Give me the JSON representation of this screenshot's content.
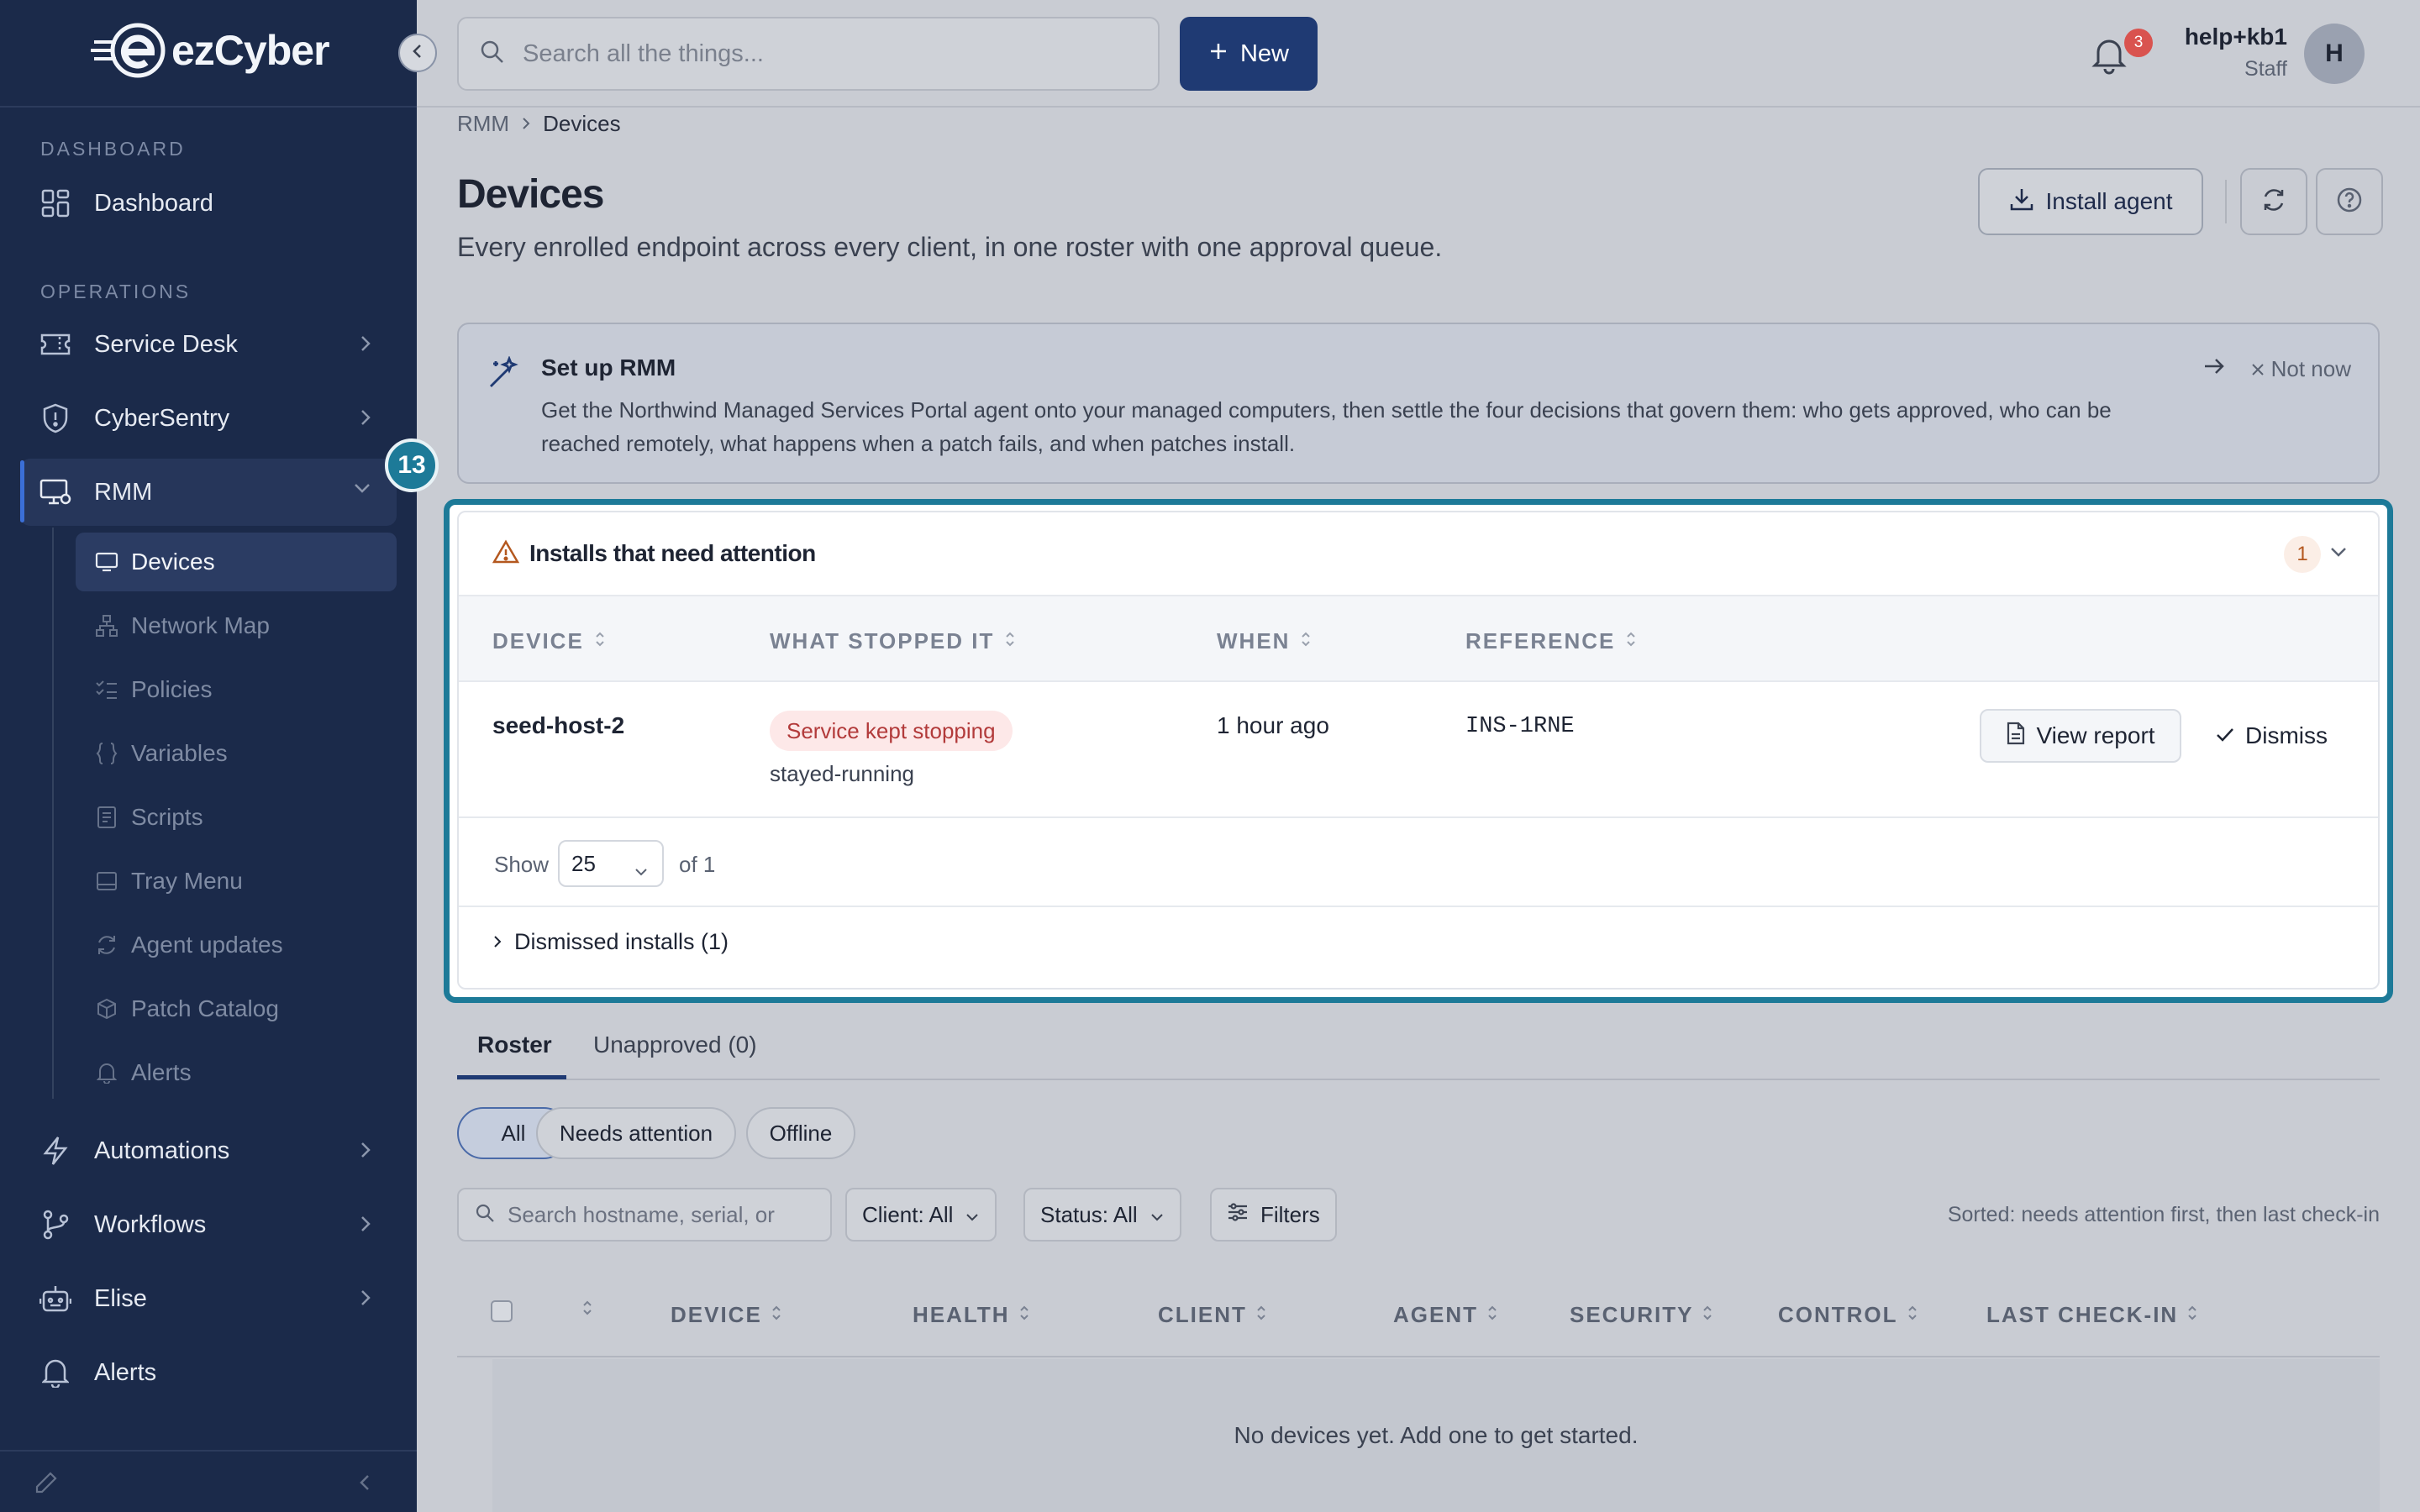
{
  "brand": {
    "name": "ezCyber",
    "accent": "#1f3a73",
    "sidebar_bg": "#1b2a4a",
    "highlight": "#1d7a98"
  },
  "sidebar": {
    "sections": {
      "dashboard": "DASHBOARD",
      "operations": "OPERATIONS"
    },
    "items": {
      "dashboard": "Dashboard",
      "service_desk": "Service Desk",
      "cybersentry": "CyberSentry",
      "rmm": "RMM",
      "automations": "Automations",
      "workflows": "Workflows",
      "elise": "Elise",
      "alerts": "Alerts"
    },
    "rmm_sub": [
      "Devices",
      "Network Map",
      "Policies",
      "Variables",
      "Scripts",
      "Tray Menu",
      "Agent updates",
      "Patch Catalog",
      "Alerts"
    ]
  },
  "topbar": {
    "search_placeholder": "Search all the things...",
    "new_label": "New",
    "notification_count": "3",
    "user_name": "help+kb1",
    "user_role": "Staff",
    "avatar_initial": "H"
  },
  "breadcrumb": {
    "parent": "RMM",
    "current": "Devices"
  },
  "page": {
    "title": "Devices",
    "subtitle": "Every enrolled endpoint across every client, in one roster with one approval queue.",
    "install_label": "Install agent"
  },
  "setup": {
    "title": "Set up RMM",
    "body": "Get the Northwind Managed Services Portal agent onto your managed computers, then settle the four decisions that govern them: who gets approved, who can be reached remotely, what happens when a patch fails, and when patches install.",
    "not_now": "Not now"
  },
  "step_badge": "13",
  "installs": {
    "title": "Installs that need attention",
    "count": "1",
    "columns": [
      "DEVICE",
      "WHAT STOPPED IT",
      "WHEN",
      "REFERENCE"
    ],
    "row": {
      "device": "seed-host-2",
      "reason": "Service kept stopping",
      "reason_detail": "stayed-running",
      "when": "1 hour ago",
      "reference": "INS-1RNE",
      "view_label": "View report",
      "dismiss_label": "Dismiss"
    },
    "pager": {
      "show": "Show",
      "page_size": "25",
      "of": "of 1"
    },
    "dismissed": "Dismissed installs (1)"
  },
  "tabs": {
    "roster": "Roster",
    "unapproved": "Unapproved (0)"
  },
  "chips": {
    "all": "All",
    "needs_attention": "Needs attention",
    "offline": "Offline"
  },
  "filters": {
    "search_placeholder": "Search hostname, serial, or",
    "client": "Client: All",
    "status": "Status: All",
    "filters": "Filters",
    "sorted": "Sorted: needs attention first, then last check-in"
  },
  "roster": {
    "columns": [
      "DEVICE",
      "HEALTH",
      "CLIENT",
      "AGENT",
      "SECURITY",
      "CONTROL",
      "LAST CHECK-IN"
    ],
    "empty": "No devices yet. Add one to get started."
  }
}
